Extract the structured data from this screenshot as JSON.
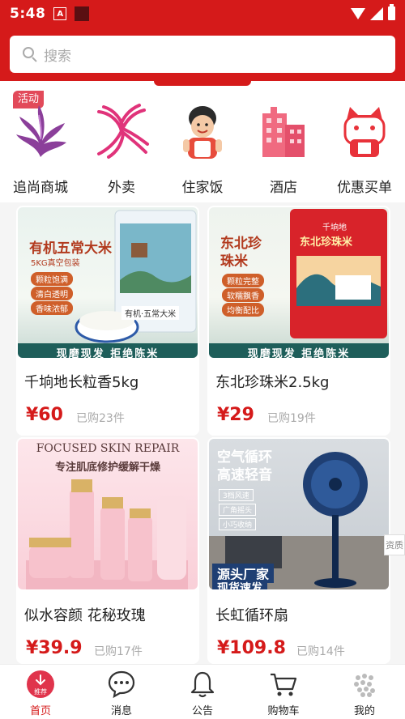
{
  "status_bar": {
    "time": "5:48",
    "notif_letter": "A"
  },
  "search": {
    "placeholder": "搜索"
  },
  "categories": [
    {
      "label": "追尚商城",
      "badge": "活动",
      "icon": "purple-bird-logo-icon"
    },
    {
      "label": "外卖",
      "icon": "pink-swirl-logo-icon"
    },
    {
      "label": "住家饭",
      "icon": "chef-lady-icon"
    },
    {
      "label": "酒店",
      "icon": "pink-building-icon"
    },
    {
      "label": "优惠买单",
      "icon": "lucky-cat-icon"
    }
  ],
  "products": [
    {
      "name": "千垧地长粒香5kg",
      "price": "¥60",
      "sold": "已购23件",
      "image": {
        "headline": "有机五常大米",
        "subhead": "5KG真空包装",
        "tags": [
          "颗粒饱满",
          "清白透明",
          "香味浓郁"
        ],
        "bag_label": "有机·五常大米",
        "footer": "现磨现发 拒绝陈米"
      }
    },
    {
      "name": "东北珍珠米2.5kg",
      "price": "¥29",
      "sold": "已购19件",
      "image": {
        "headline": "东北珍珠米",
        "tags": [
          "颗粒完整",
          "软糯飘香",
          "均衡配比"
        ],
        "bag_brand": "千垧地",
        "bag_label": "东北珍珠米",
        "footer": "现磨现发 拒绝陈米"
      }
    },
    {
      "name": "似水容颜 花秘玫瑰",
      "price": "¥39.9",
      "sold": "已购17件",
      "image": {
        "headline": "FOCUSED SKIN REPAIR",
        "subhead": "专注肌底修护缓解干燥"
      }
    },
    {
      "name": "长虹循环扇",
      "price": "¥109.8",
      "sold": "已购14件",
      "image": {
        "headline": "空气循环",
        "headline2": "高速轻音",
        "tags": [
          "3档风速",
          "广角摇头",
          "小巧收纳"
        ],
        "footer": "源头厂家",
        "footer2": "现货速发"
      }
    }
  ],
  "side_tab": "资质",
  "bottom_nav": [
    {
      "label": "首页",
      "badge": "推荐",
      "icon": "home-recommend-icon",
      "active": true
    },
    {
      "label": "消息",
      "icon": "chat-bubble-icon"
    },
    {
      "label": "公告",
      "icon": "bell-icon"
    },
    {
      "label": "购物车",
      "icon": "cart-icon"
    },
    {
      "label": "我的",
      "icon": "avatar-icon"
    }
  ],
  "colors": {
    "brand": "#d51a1a",
    "price": "#d51a1a",
    "muted": "#aaaaaa"
  }
}
